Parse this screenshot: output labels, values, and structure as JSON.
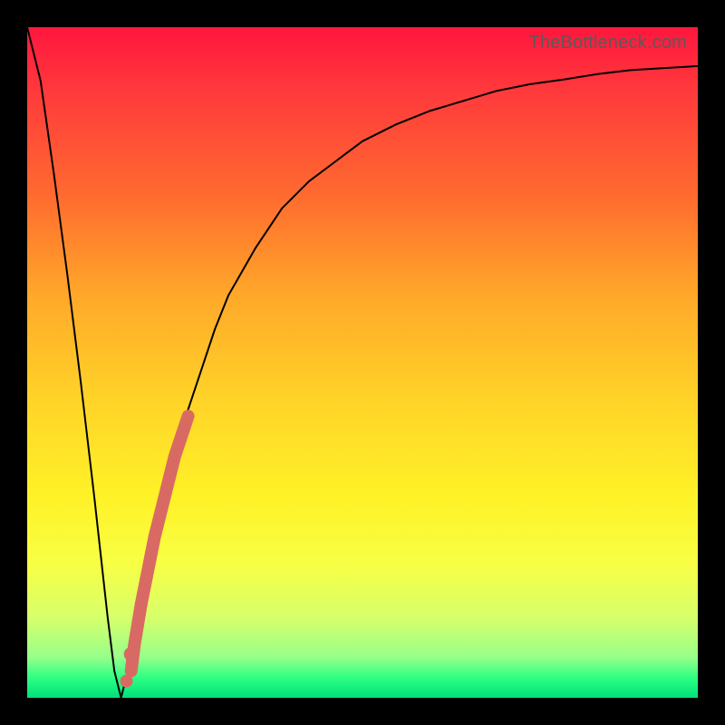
{
  "watermark": {
    "text": "TheBottleneck.com"
  },
  "chart_data": {
    "type": "line",
    "title": "",
    "xlabel": "",
    "ylabel": "",
    "xlim": [
      0,
      100
    ],
    "ylim": [
      0,
      100
    ],
    "series": [
      {
        "name": "curve",
        "x": [
          0,
          2,
          4,
          6,
          8,
          10,
          11,
          12,
          13,
          14,
          15,
          16,
          18,
          20,
          22,
          24,
          26,
          28,
          30,
          34,
          38,
          42,
          46,
          50,
          55,
          60,
          65,
          70,
          75,
          80,
          85,
          90,
          95,
          100
        ],
        "y": [
          100,
          92,
          78,
          63,
          47,
          30,
          21,
          12,
          4,
          0,
          4,
          9,
          19,
          28,
          36,
          43,
          49,
          55,
          60,
          67,
          73,
          77,
          80,
          83,
          85.5,
          87.5,
          89,
          90.5,
          91.5,
          92.2,
          93,
          93.6,
          93.9,
          94.2
        ]
      },
      {
        "name": "highlight-segment",
        "x": [
          15.5,
          16,
          17,
          18,
          19,
          20,
          21,
          22,
          23,
          24
        ],
        "y": [
          4,
          8,
          14,
          19,
          24,
          28,
          32,
          36,
          39,
          42
        ]
      },
      {
        "name": "highlight-dot-upper",
        "x": [
          15.5
        ],
        "y": [
          6.5
        ]
      },
      {
        "name": "highlight-dot-lower",
        "x": [
          14.8
        ],
        "y": [
          2.5
        ]
      }
    ],
    "colors": {
      "curve": "#000000",
      "highlight": "#d86a63"
    }
  }
}
